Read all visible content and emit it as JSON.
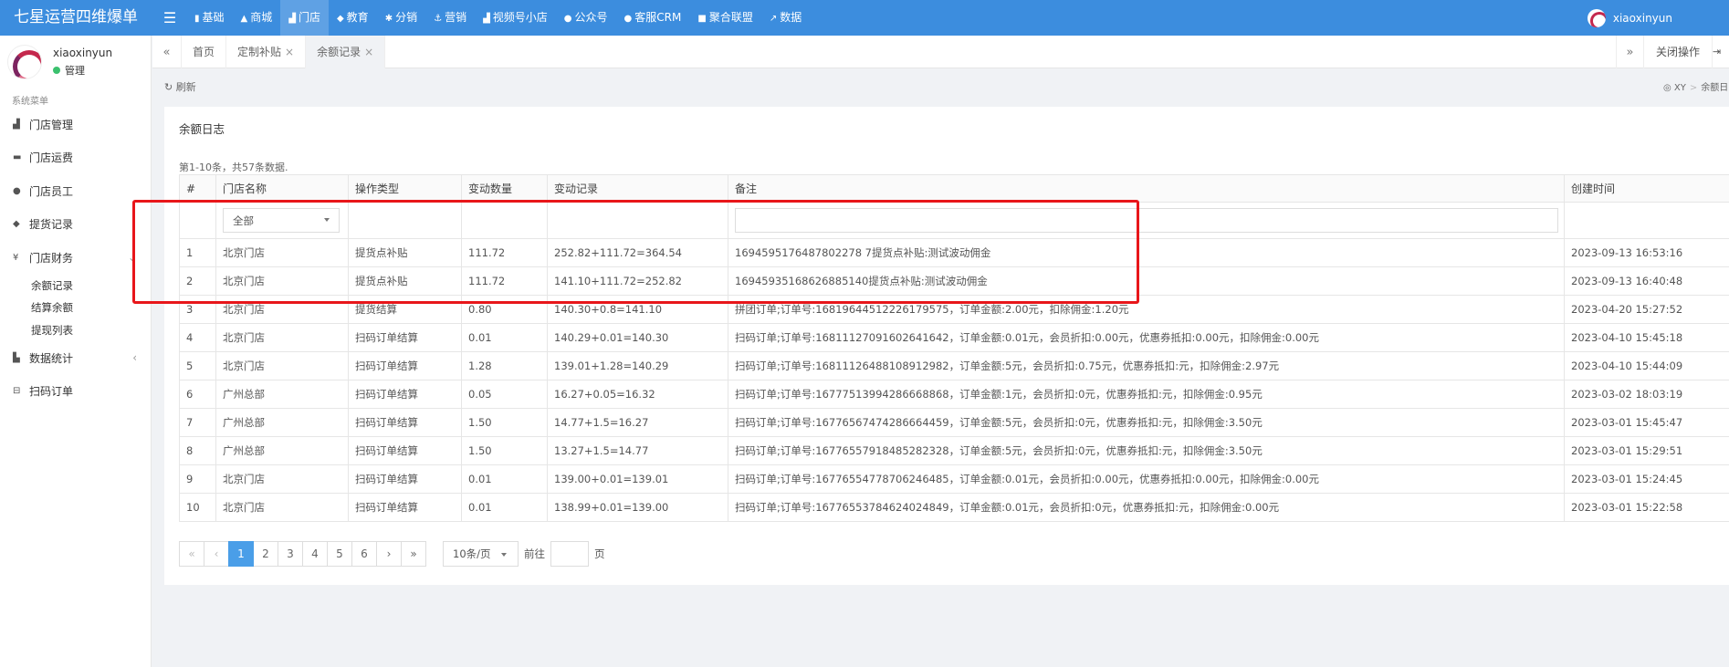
{
  "app": {
    "brand": "七星运营四维爆单",
    "user": "xiaoxinyun"
  },
  "topnav": [
    {
      "icon": "bookmark-icon",
      "glyph": "▮",
      "label": "基础"
    },
    {
      "icon": "shop-icon",
      "glyph": "▲",
      "label": "商城"
    },
    {
      "icon": "store-icon",
      "glyph": "▟",
      "label": "门店",
      "active": true
    },
    {
      "icon": "graduation-icon",
      "glyph": "◆",
      "label": "教育"
    },
    {
      "icon": "gear-icon",
      "glyph": "✱",
      "label": "分销"
    },
    {
      "icon": "anchor-icon",
      "glyph": "⚓",
      "label": "营销"
    },
    {
      "icon": "sitemap-icon",
      "glyph": "▟",
      "label": "视频号小店"
    },
    {
      "icon": "wechat-icon",
      "glyph": "●",
      "label": "公众号"
    },
    {
      "icon": "chat-icon",
      "glyph": "●",
      "label": "客服CRM"
    },
    {
      "icon": "puzzle-icon",
      "glyph": "■",
      "label": "聚合联盟"
    },
    {
      "icon": "chart-line-icon",
      "glyph": "↗",
      "label": "数据"
    }
  ],
  "sidebar": {
    "user_name": "xiaoxinyun",
    "user_role": "管理",
    "section_title": "系统菜单",
    "items": [
      {
        "icon": "store-icon",
        "glyph": "▟",
        "label": "门店管理"
      },
      {
        "icon": "truck-icon",
        "glyph": "▬",
        "label": "门店运费"
      },
      {
        "icon": "users-icon",
        "glyph": "●",
        "label": "门店员工"
      },
      {
        "icon": "tags-icon",
        "glyph": "◆",
        "label": "提货记录"
      },
      {
        "icon": "yen-icon",
        "glyph": "¥",
        "label": "门店财务",
        "caret": "⌄"
      },
      {
        "icon": "bar-chart-icon",
        "glyph": "▙",
        "label": "数据统计",
        "caret": "‹"
      },
      {
        "icon": "minus-square-icon",
        "glyph": "⊟",
        "label": "扫码订单"
      }
    ],
    "sub_items": [
      "余额记录",
      "结算余额",
      "提现列表"
    ]
  },
  "tabs": {
    "prev": "«",
    "next": "»",
    "items": [
      {
        "label": "首页",
        "closable": false
      },
      {
        "label": "定制补贴",
        "closable": true
      },
      {
        "label": "余额记录",
        "closable": true,
        "active": true
      }
    ],
    "close_ops": "关闭操作",
    "exit_glyph": "⇥ 退"
  },
  "toolbar": {
    "refresh": "刷新",
    "refresh_glyph": "↻"
  },
  "breadcrumb": {
    "glyph": "◎",
    "root": "XY",
    "current": "余额日"
  },
  "panel": {
    "title": "余额日志",
    "summary_prefix": "第",
    "summary_range": "1-10",
    "summary_mid": "条，共",
    "summary_total": "57",
    "summary_suffix": "条数据."
  },
  "table": {
    "columns": [
      "#",
      "门店名称",
      "操作类型",
      "变动数量",
      "变动记录",
      "备注",
      "创建时间"
    ],
    "filter": {
      "store_select": "全部"
    },
    "rows": [
      [
        "1",
        "北京门店",
        "提货点补贴",
        "111.72",
        "252.82+111.72=364.54",
        "1694595176487802278 7提货点补贴:测试波动佣金",
        "2023-09-13 16:53:16"
      ],
      [
        "2",
        "北京门店",
        "提货点补贴",
        "111.72",
        "141.10+111.72=252.82",
        "16945935168626885140提货点补贴:测试波动佣金",
        "2023-09-13 16:40:48"
      ],
      [
        "3",
        "北京门店",
        "提货结算",
        "0.80",
        "140.30+0.8=141.10",
        "拼团订单;订单号:16819644512226179575，订单金额:2.00元，扣除佣金:1.20元",
        "2023-04-20 15:27:52"
      ],
      [
        "4",
        "北京门店",
        "扫码订单结算",
        "0.01",
        "140.29+0.01=140.30",
        "扫码订单;订单号:16811127091602641642，订单金额:0.01元，会员折扣:0.00元，优惠券抵扣:0.00元，扣除佣金:0.00元",
        "2023-04-10 15:45:18"
      ],
      [
        "5",
        "北京门店",
        "扫码订单结算",
        "1.28",
        "139.01+1.28=140.29",
        "扫码订单;订单号:16811126488108912982，订单金额:5元，会员折扣:0.75元，优惠券抵扣:元，扣除佣金:2.97元",
        "2023-04-10 15:44:09"
      ],
      [
        "6",
        "广州总部",
        "扫码订单结算",
        "0.05",
        "16.27+0.05=16.32",
        "扫码订单;订单号:16777513994286668868，订单金额:1元，会员折扣:0元，优惠券抵扣:元，扣除佣金:0.95元",
        "2023-03-02 18:03:19"
      ],
      [
        "7",
        "广州总部",
        "扫码订单结算",
        "1.50",
        "14.77+1.5=16.27",
        "扫码订单;订单号:16776567474286664459，订单金额:5元，会员折扣:0元，优惠券抵扣:元，扣除佣金:3.50元",
        "2023-03-01 15:45:47"
      ],
      [
        "8",
        "广州总部",
        "扫码订单结算",
        "1.50",
        "13.27+1.5=14.77",
        "扫码订单;订单号:16776557918485282328，订单金额:5元，会员折扣:0元，优惠券抵扣:元，扣除佣金:3.50元",
        "2023-03-01 15:29:51"
      ],
      [
        "9",
        "北京门店",
        "扫码订单结算",
        "0.01",
        "139.00+0.01=139.01",
        "扫码订单;订单号:16776554778706246485，订单金额:0.01元，会员折扣:0.00元，优惠券抵扣:0.00元，扣除佣金:0.00元",
        "2023-03-01 15:24:45"
      ],
      [
        "10",
        "北京门店",
        "扫码订单结算",
        "0.01",
        "138.99+0.01=139.00",
        "扫码订单;订单号:16776553784624024849，订单金额:0.01元，会员折扣:0元，优惠券抵扣:元，扣除佣金:0.00元",
        "2023-03-01 15:22:58"
      ]
    ]
  },
  "pagination": {
    "first": "«",
    "prev": "‹",
    "pages": [
      "1",
      "2",
      "3",
      "4",
      "5",
      "6"
    ],
    "current": "1",
    "next": "›",
    "last": "»",
    "page_size": "10条/页",
    "goto_label": "前往",
    "page_suffix": "页"
  },
  "colors": {
    "accent": "#3c8dde",
    "annotation": "#e8161a",
    "page_active": "#4a9ee8"
  }
}
